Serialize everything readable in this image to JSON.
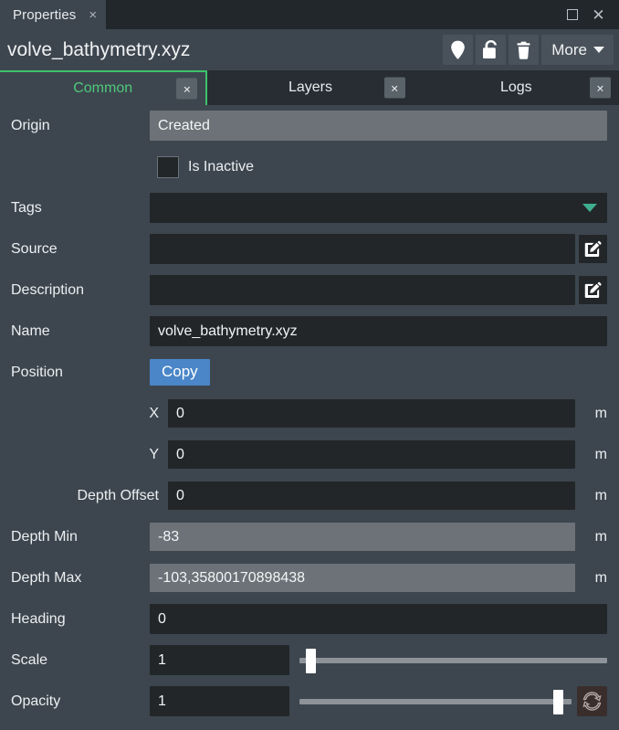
{
  "window": {
    "tab_label": "Properties",
    "tab_close": "×",
    "maximize_icon": "maximize-icon",
    "close_icon": "close-icon"
  },
  "header": {
    "file_title": "volve_bathymetry.xyz",
    "actions": [
      {
        "name": "pin-icon",
        "label": ""
      },
      {
        "name": "unlock-icon",
        "label": ""
      },
      {
        "name": "trash-icon",
        "label": ""
      }
    ],
    "more_label": "More"
  },
  "tabs": [
    {
      "label": "Common",
      "active": true,
      "close": "×"
    },
    {
      "label": "Layers",
      "active": false,
      "close": "×"
    },
    {
      "label": "Logs",
      "active": false,
      "close": "×"
    }
  ],
  "form": {
    "origin": {
      "label": "Origin",
      "value": "Created"
    },
    "is_inactive": {
      "label": "Is Inactive",
      "checked": false
    },
    "tags": {
      "label": "Tags",
      "value": ""
    },
    "source": {
      "label": "Source",
      "value": ""
    },
    "description": {
      "label": "Description",
      "value": ""
    },
    "name": {
      "label": "Name",
      "value": "volve_bathymetry.xyz"
    },
    "position": {
      "label": "Position",
      "copy_label": "Copy"
    },
    "x": {
      "label": "X",
      "value": "0",
      "unit": "m"
    },
    "y": {
      "label": "Y",
      "value": "0",
      "unit": "m"
    },
    "depth_offset": {
      "label": "Depth Offset",
      "value": "0",
      "unit": "m"
    },
    "depth_min": {
      "label": "Depth Min",
      "value": "-83",
      "unit": "m"
    },
    "depth_max": {
      "label": "Depth Max",
      "value": "-103,35800170898438",
      "unit": "m"
    },
    "heading": {
      "label": "Heading",
      "value": "0"
    },
    "scale": {
      "label": "Scale",
      "value": "1",
      "slider_percent": 2
    },
    "opacity": {
      "label": "Opacity",
      "value": "1",
      "slider_percent": 97,
      "reset_icon": "refresh-icon"
    }
  },
  "colors": {
    "accent_green": "#4ec97a",
    "accent_blue": "#4a86c8",
    "panel_bg": "#3d464f",
    "field_bg": "#232628",
    "readonly_bg": "#6c7277",
    "chevron_teal": "#3fae8e"
  }
}
